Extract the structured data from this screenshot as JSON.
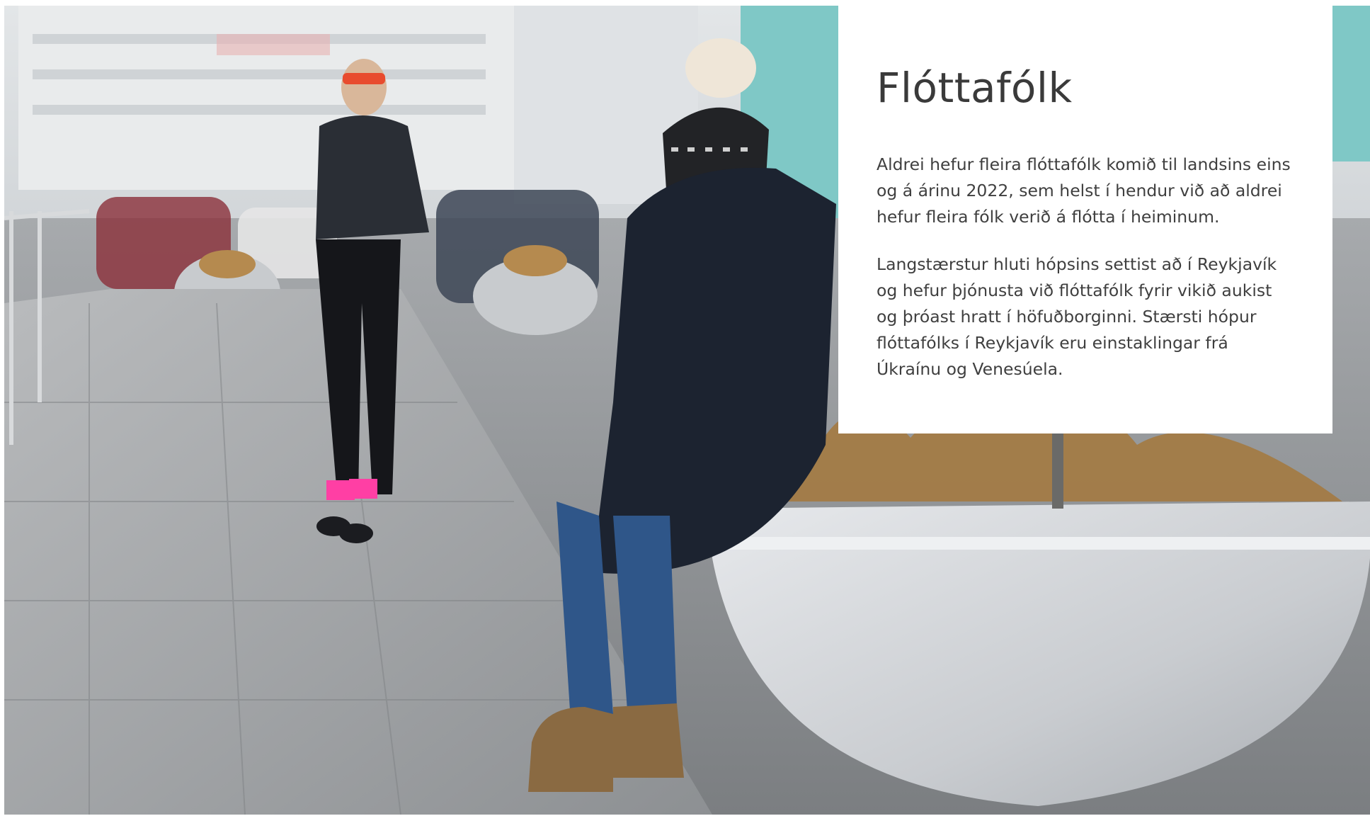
{
  "article": {
    "title": "Flóttafólk",
    "paragraphs": [
      "Aldrei hefur fleira flóttafólk komið til landsins eins og á árinu 2022, sem helst í hendur við að aldrei hefur fleira fólk verið á flótta í heiminum.",
      "Langstærstur hluti hópsins settist að í Reykjavík og hefur þjónusta við flóttafólk fyrir vikið aukist og þróast hratt í höfuðborginni. Stærsti hópur flóttafólks í Reykjavík eru einstaklingar frá Úkraínu og Venesúela."
    ]
  },
  "colors": {
    "card_background": "#ffffff",
    "title_text": "#3a3a3a",
    "body_text": "#3f3f3f"
  }
}
